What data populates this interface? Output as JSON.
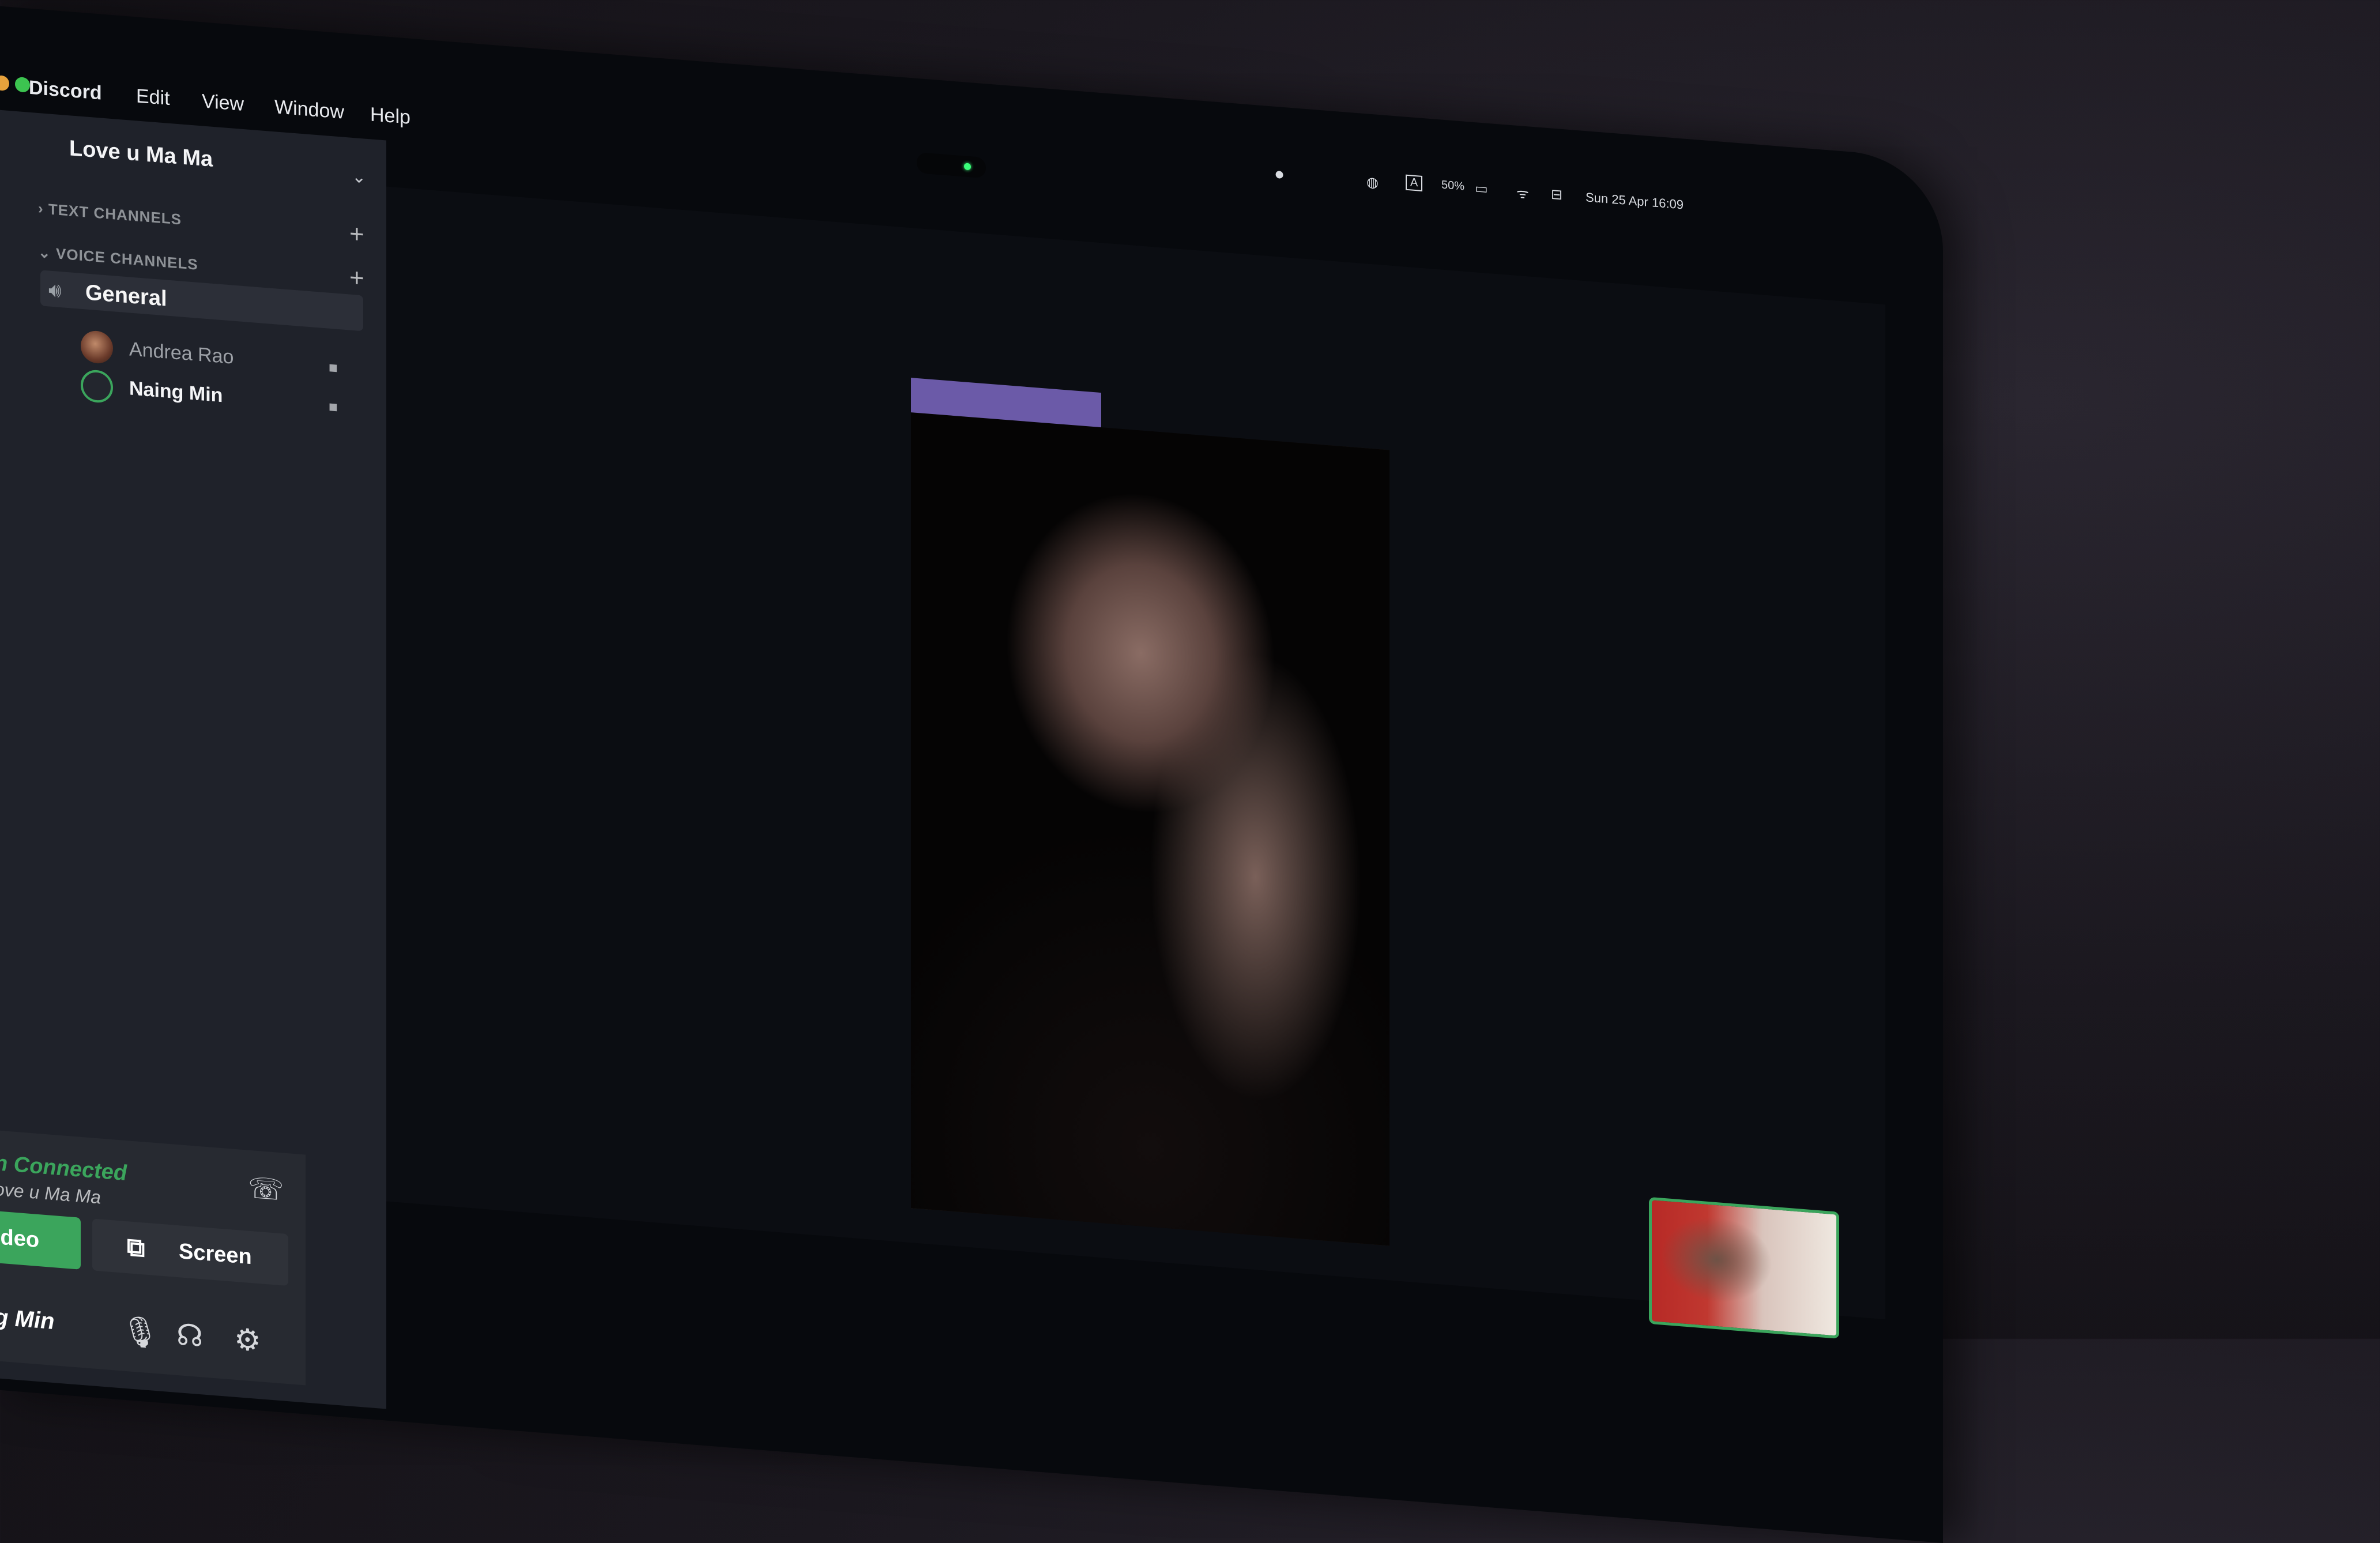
{
  "menubar": {
    "app_name": "Discord",
    "items": [
      "Edit",
      "View",
      "Window",
      "Help"
    ],
    "status": {
      "battery": "50%",
      "keyboard_input": "A",
      "datetime": "Sun 25 Apr  16:09"
    }
  },
  "server": {
    "name": "Love u Ma Ma",
    "categories": {
      "text": "TEXT CHANNELS",
      "voice": "VOICE CHANNELS"
    },
    "voice_channel": {
      "name": "General",
      "members": [
        "Andrea Rao",
        "Naing Min"
      ]
    }
  },
  "voice_panel": {
    "status": "n Connected",
    "channel": "ove u Ma Ma",
    "video_label": "ideo",
    "screen_label": "Screen"
  },
  "user": {
    "name": "g Min"
  },
  "colors": {
    "connected_green": "#3ba55c",
    "sidebar_bg": "#1f222a",
    "screen_bg": "#07090d"
  }
}
